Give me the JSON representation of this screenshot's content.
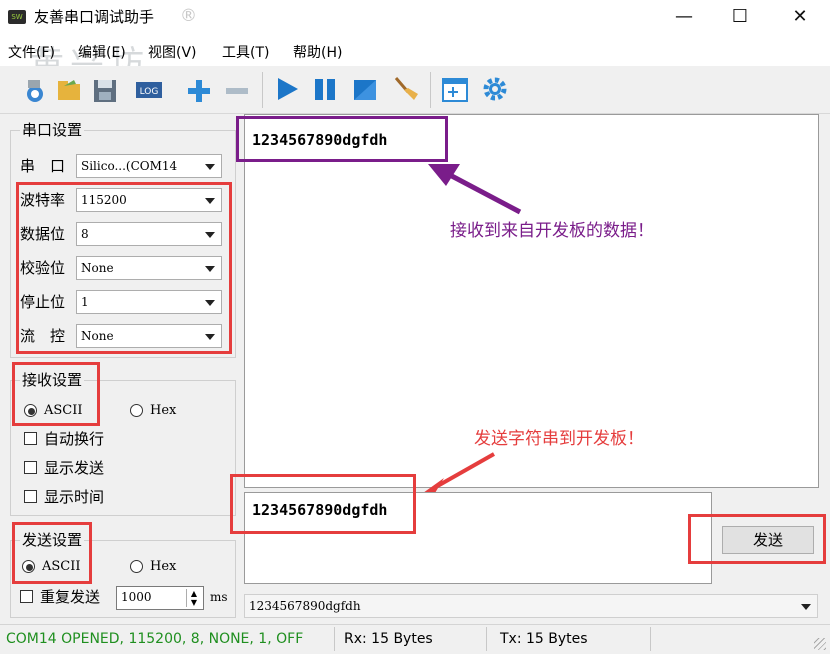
{
  "window": {
    "title": "友善串口调试助手",
    "registered_mark": "®",
    "icon_text": "SW",
    "minimize_label": "—",
    "maximize_label": "☐",
    "close_label": "✕"
  },
  "watermark": "黄兴坊",
  "menu": [
    "文件(F)",
    "编辑(E)",
    "视图(V)",
    "工具(T)",
    "帮助(H)"
  ],
  "toolbar": {
    "icons": [
      "new-connection-icon",
      "open-folder-icon",
      "save-icon",
      "log-icon",
      "zoom-in-icon",
      "zoom-out-icon",
      "play-icon",
      "pause-icon",
      "stop-icon",
      "clear-broom-icon",
      "add-panel-icon",
      "settings-gear-icon"
    ],
    "log_text": "LOG"
  },
  "serial_settings": {
    "title": "串口设置",
    "port_label": "串　口",
    "port_value": "Silico...(COM14",
    "baud_label": "波特率",
    "baud_value": "115200",
    "databits_label": "数据位",
    "databits_value": "8",
    "parity_label": "校验位",
    "parity_value": "None",
    "stopbits_label": "停止位",
    "stopbits_value": "1",
    "flow_label": "流　控",
    "flow_value": "None"
  },
  "receive_settings": {
    "title": "接收设置",
    "ascii_label": "ASCII",
    "hex_label": "Hex",
    "ascii_selected": true,
    "auto_wrap_label": "自动换行",
    "show_send_label": "显示发送",
    "show_time_label": "显示时间"
  },
  "send_settings": {
    "title": "发送设置",
    "ascii_label": "ASCII",
    "hex_label": "Hex",
    "ascii_selected": true,
    "repeat_label": "重复发送",
    "repeat_interval": "1000",
    "interval_unit": "ms"
  },
  "receive_text": "1234567890dgfdh",
  "send_text": "1234567890dgfdh",
  "send_button_label": "发送",
  "history_value": "1234567890dgfdh",
  "annotations": {
    "receive_note": "接收到来自开发板的数据！",
    "send_note": "发送字符串到开发板！",
    "receive_color": "#7a1d8a",
    "send_color": "#e53d3d"
  },
  "status": {
    "connection": "COM14 OPENED, 115200, 8, NONE, 1, OFF",
    "rx": "Rx: 15 Bytes",
    "tx": "Tx: 15 Bytes",
    "connection_color": "#1f8f1f"
  }
}
